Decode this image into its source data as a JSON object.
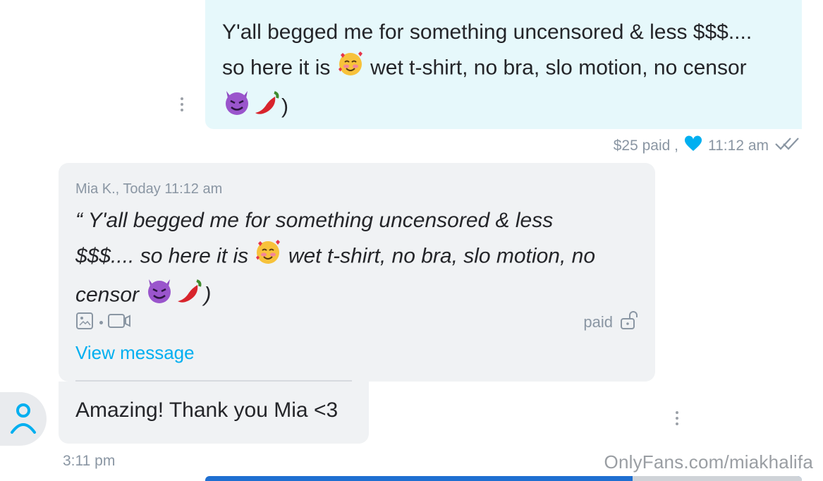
{
  "outgoing": {
    "line1": "Y'all begged me for something uncensored & less $$$....",
    "line2_pre": "so here it is",
    "line2_post": "wet t-shirt, no bra, slo motion, no censor",
    "line3_post": ")",
    "emojis": [
      "smiling-face-with-hearts",
      "smiling-devil",
      "hot-pepper"
    ],
    "price": "$25 paid ,",
    "time": "11:12 am",
    "accent_color": "#00aff0"
  },
  "incoming": {
    "sender": "Mia K., Today 11:12 am",
    "quote_line1": "“ Y'all begged me for something uncensored & less",
    "quote_line2_pre": "$$$.... so here it is",
    "quote_line2_post": "wet t-shirt, no bra, slo motion, no",
    "quote_line3_pre": "censor",
    "quote_line3_post": ")",
    "media_icons": [
      "image-icon",
      "video-icon"
    ],
    "paid_label": "paid",
    "view_link": "View message"
  },
  "reply": {
    "text": "Amazing! Thank you Mia <3",
    "time": "3:11 pm"
  },
  "watermark": "OnlyFans.com/miakhalifa"
}
